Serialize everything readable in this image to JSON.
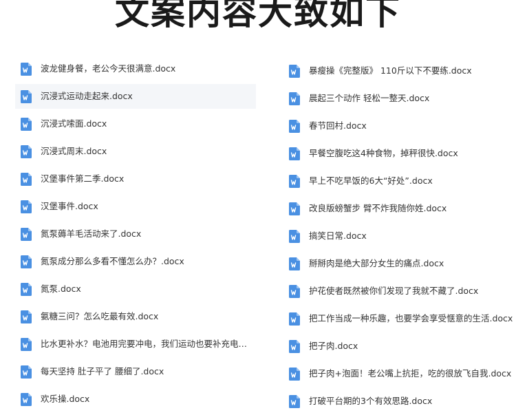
{
  "title": "文案内容大致如下",
  "colors": {
    "icon_fill": "#4a90e2",
    "icon_fold": "#9cc4f3",
    "selected_row": "#f4f6f9",
    "text": "#333333"
  },
  "left_files": [
    {
      "name": "波龙健身餐，老公今天很满意.docx",
      "icon": "word-doc-icon",
      "selected": false
    },
    {
      "name": "沉浸式运动走起来.docx",
      "icon": "word-doc-icon",
      "selected": true
    },
    {
      "name": "沉浸式嗦面.docx",
      "icon": "word-doc-icon",
      "selected": false
    },
    {
      "name": "沉浸式周末.docx",
      "icon": "word-doc-icon",
      "selected": false
    },
    {
      "name": "汉堡事件第二季.docx",
      "icon": "word-doc-icon",
      "selected": false
    },
    {
      "name": "汉堡事件.docx",
      "icon": "word-doc-icon",
      "selected": false
    },
    {
      "name": "氮泵薅羊毛活动来了.docx",
      "icon": "word-doc-icon",
      "selected": false
    },
    {
      "name": "氮泵成分那么多看不懂怎么办？.docx",
      "icon": "word-doc-icon",
      "selected": false
    },
    {
      "name": "氮泵.docx",
      "icon": "word-doc-icon",
      "selected": false
    },
    {
      "name": "氨糖三问？怎么吃最有效.docx",
      "icon": "word-doc-icon",
      "selected": false
    },
    {
      "name": "比水更补水？电池用完要冲电，我们运动也要补充电解质...",
      "icon": "word-doc-icon",
      "selected": false
    },
    {
      "name": "每天坚持 肚子平了 腰细了.docx",
      "icon": "word-doc-icon",
      "selected": false
    },
    {
      "name": "欢乐操.docx",
      "icon": "word-doc-icon",
      "selected": false
    }
  ],
  "right_files": [
    {
      "name": "暴瘦操《完整版》 110斤以下不要练.docx",
      "icon": "word-doc-icon",
      "selected": false
    },
    {
      "name": "晨起三个动作 轻松一整天.docx",
      "icon": "word-doc-icon",
      "selected": false
    },
    {
      "name": "春节回村.docx",
      "icon": "word-doc-icon",
      "selected": false
    },
    {
      "name": "早餐空腹吃这4种食物，掉秤很快.docx",
      "icon": "word-doc-icon",
      "selected": false
    },
    {
      "name": "早上不吃早饭的6大“好处”.docx",
      "icon": "word-doc-icon",
      "selected": false
    },
    {
      "name": "改良版螃蟹步 臂不炸我随你姓.docx",
      "icon": "word-doc-icon",
      "selected": false
    },
    {
      "name": "搞笑日常.docx",
      "icon": "word-doc-icon",
      "selected": false
    },
    {
      "name": "掰掰肉是绝大部分女生的痛点.docx",
      "icon": "word-doc-icon",
      "selected": false
    },
    {
      "name": "护花使者既然被你们发现了我就不藏了.docx",
      "icon": "word-doc-icon",
      "selected": false
    },
    {
      "name": "把工作当成一种乐趣，也要学会享受惬意的生活.docx",
      "icon": "word-doc-icon",
      "selected": false
    },
    {
      "name": "把子肉.docx",
      "icon": "word-doc-icon",
      "selected": false
    },
    {
      "name": "把子肉+泡面！老公嘴上抗拒，吃的很放飞自我.docx",
      "icon": "word-doc-icon",
      "selected": false
    },
    {
      "name": "打破平台期的3个有效思路.docx",
      "icon": "word-doc-icon",
      "selected": false
    }
  ]
}
